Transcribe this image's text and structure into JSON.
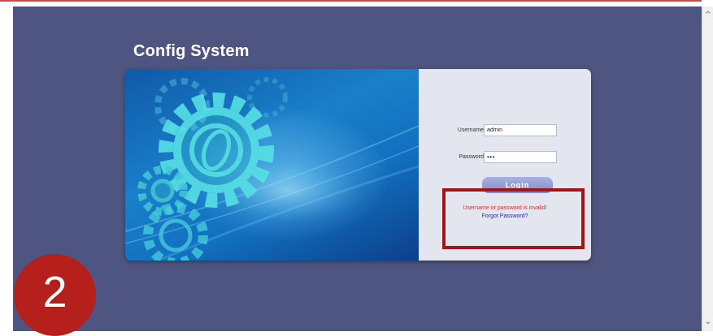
{
  "app": {
    "title": "Config System"
  },
  "form": {
    "username_label": "Username:",
    "username_value": "admin",
    "password_label": "Password:",
    "password_value": "•••",
    "login_label": "Login",
    "error_message": "Username or password is invalid!",
    "forgot_link": "Forgot Password?"
  },
  "annotation": {
    "step_number": "2"
  },
  "icons": [
    "gear-icon",
    "scroll-up-arrow-icon",
    "scroll-down-arrow-icon"
  ],
  "colors": {
    "page_background": "#4e5580",
    "error_text": "#e0282a",
    "link_text": "#1a2ab8",
    "highlight": "#a51412",
    "badge": "#b51f1c"
  }
}
